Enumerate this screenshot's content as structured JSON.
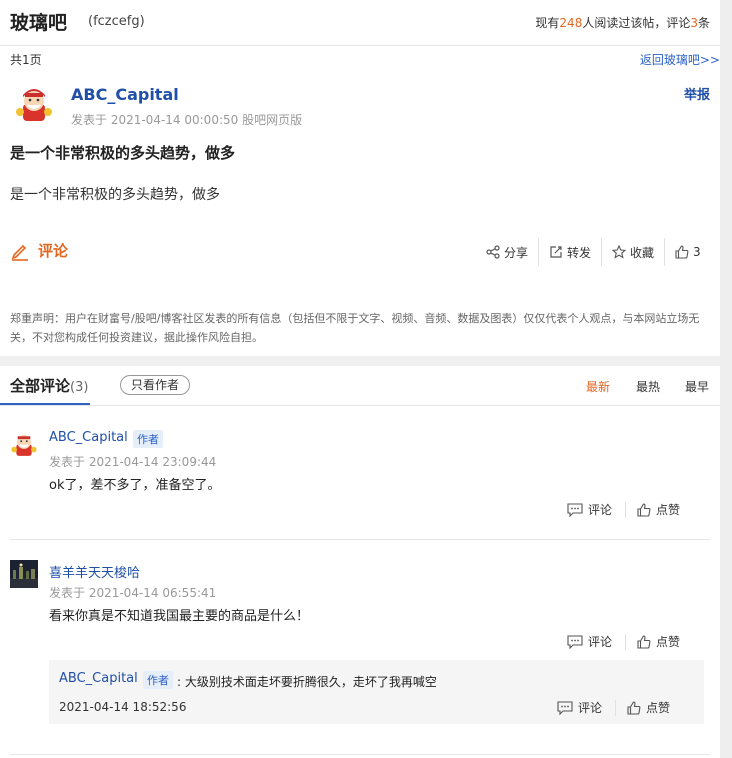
{
  "header": {
    "bar_name": "玻璃吧",
    "bar_code": "(fczcefg)",
    "stats_prefix": "现有",
    "readers": "248",
    "stats_mid": "人阅读过该帖，评论",
    "comments": "3",
    "stats_suffix": "条"
  },
  "pager": {
    "pages": "共1页",
    "back_link": "返回玻璃吧>>"
  },
  "post": {
    "author": "ABC_Capital",
    "report": "举报",
    "meta": "发表于 2021-04-14 00:00:50 股吧网页版",
    "title": "是一个非常积极的多头趋势，做多",
    "body": "是一个非常积极的多头趋势，做多",
    "comment_label": "评论",
    "actions": {
      "share": "分享",
      "forward": "转发",
      "favorite": "收藏",
      "likes": "3"
    },
    "disclaimer": "郑重声明：用户在财富号/股吧/博客社区发表的所有信息（包括但不限于文字、视频、音频、数据及图表）仅仅代表个人观点，与本网站立场无关，不对您构成任何投资建议，据此操作风险自担。"
  },
  "comments_section": {
    "title": "全部评论",
    "count": "(3)",
    "author_only": "只看作者",
    "sort": {
      "newest": "最新",
      "hottest": "最热",
      "earliest": "最早"
    }
  },
  "comments": [
    {
      "author": "ABC_Capital",
      "badge": "作者",
      "time": "发表于 2021-04-14 23:09:44",
      "text": "ok了，差不多了，准备空了。",
      "reply_label": "评论",
      "like_label": "点赞"
    },
    {
      "author": "喜羊羊天天梭哈",
      "time": "发表于 2021-04-14 06:55:41",
      "text": "看来你真是不知道我国最主要的商品是什么！",
      "reply_label": "评论",
      "like_label": "点赞",
      "reply": {
        "author": "ABC_Capital",
        "badge": "作者",
        "text": ": 大级别技术面走坏要折腾很久，走坏了我再喊空",
        "time": "2021-04-14 18:52:56",
        "reply_label": "评论",
        "like_label": "点赞"
      }
    }
  ],
  "colors": {
    "accent": "#e4671f",
    "link": "#1f4fa8",
    "badge_bg": "#e6eef9"
  }
}
